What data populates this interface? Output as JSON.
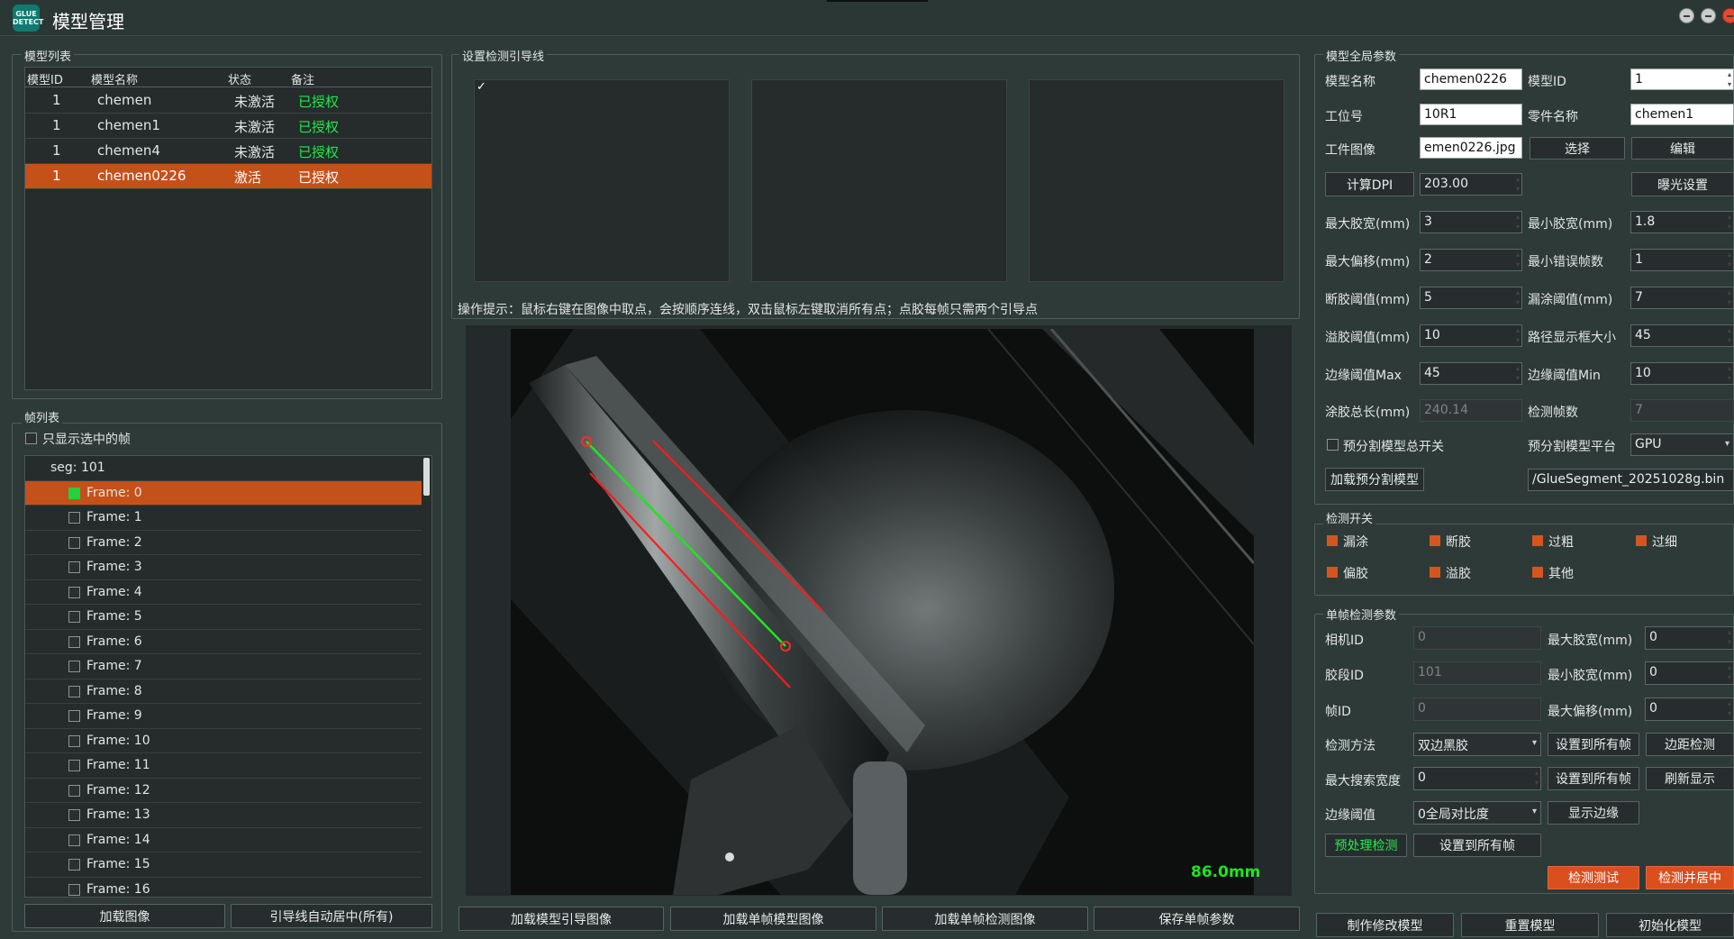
{
  "app": {
    "title": "模型管理",
    "logo_text": "GLUE DETECT"
  },
  "model_list": {
    "title": "模型列表",
    "columns": [
      "模型ID",
      "模型名称",
      "状态",
      "备注"
    ],
    "rows": [
      {
        "id": "1",
        "name": "chemen",
        "status": "未激活",
        "note": "已授权"
      },
      {
        "id": "1",
        "name": "chemen1",
        "status": "未激活",
        "note": "已授权"
      },
      {
        "id": "1",
        "name": "chemen4",
        "status": "未激活",
        "note": "已授权"
      },
      {
        "id": "1",
        "name": "chemen0226",
        "status": "激活",
        "note": "已授权"
      }
    ]
  },
  "frame_list": {
    "title": "帧列表",
    "only_selected_label": "只显示选中的帧",
    "seg_label": "seg: 101",
    "frames": [
      "Frame: 0",
      "Frame: 1",
      "Frame: 2",
      "Frame: 3",
      "Frame: 4",
      "Frame: 5",
      "Frame: 6",
      "Frame: 7",
      "Frame: 8",
      "Frame: 9",
      "Frame: 10",
      "Frame: 11",
      "Frame: 12",
      "Frame: 13",
      "Frame: 14",
      "Frame: 15",
      "Frame: 16"
    ],
    "load_image_button": "加载图像",
    "auto_center_button": "引导线自动居中(所有)"
  },
  "guide_line": {
    "title": "设置检测引导线",
    "check_mark": "✓",
    "hint": "操作提示：鼠标右键在图像中取点，会按顺序连线，双击鼠标左键取消所有点；点胶每帧只需两个引导点",
    "measure_label": "86.0mm",
    "buttons": [
      "加载模型引导图像",
      "加载单帧模型图像",
      "加载单帧检测图像",
      "保存单帧参数"
    ]
  },
  "global_params": {
    "title": "模型全局参数",
    "model_name_label": "模型名称",
    "model_name": "chemen0226",
    "model_id_label": "模型ID",
    "model_id": "1",
    "station_label": "工位号",
    "station": "10R1",
    "part_name_label": "零件名称",
    "part_name": "chemen1",
    "part_image_label": "工件图像",
    "part_image": "emen0226.jpg",
    "select_button": "选择",
    "edit_button": "编辑",
    "calc_dpi_button": "计算DPI",
    "dpi": "203.00",
    "exposure_button": "曝光设置",
    "max_width_label": "最大胶宽(mm)",
    "max_width": "3",
    "min_width_label": "最小胶宽(mm)",
    "min_width": "1.8",
    "max_offset_label": "最大偏移(mm)",
    "max_offset": "2",
    "min_error_frames_label": "最小错误帧数",
    "min_error_frames": "1",
    "break_thresh_label": "断胶阈值(mm)",
    "break_thresh": "5",
    "miss_thresh_label": "漏涂阈值(mm)",
    "miss_thresh": "7",
    "overflow_thresh_label": "溢胶阈值(mm)",
    "overflow_thresh": "10",
    "path_box_label": "路径显示框大小",
    "path_box": "45",
    "edge_max_label": "边缘阈值Max",
    "edge_max": "45",
    "edge_min_label": "边缘阈值Min",
    "edge_min": "10",
    "total_length_label": "涂胶总长(mm)",
    "total_length": "240.14",
    "frame_count_label": "检测帧数",
    "frame_count": "7",
    "preseg_switch_label": "预分割模型总开关",
    "preseg_platform_label": "预分割模型平台",
    "preseg_platform": "GPU",
    "load_preseg_button": "加载预分割模型",
    "preseg_path": "/GlueSegment_20251028g.bin"
  },
  "detect_switch": {
    "title": "检测开关",
    "items": [
      "漏涂",
      "断胶",
      "过粗",
      "过细",
      "偏胶",
      "溢胶",
      "其他"
    ]
  },
  "single_frame": {
    "title": "单帧检测参数",
    "camera_id_label": "相机ID",
    "camera_id": "0",
    "max_width_label": "最大胶宽(mm)",
    "max_width": "0",
    "segment_id_label": "胶段ID",
    "segment_id": "101",
    "min_width_label": "最小胶宽(mm)",
    "min_width": "0",
    "frame_id_label": "帧ID",
    "frame_id": "0",
    "max_offset_label": "最大偏移(mm)",
    "max_offset": "0",
    "method_label": "检测方法",
    "method": "双边黑胶",
    "apply_all_button": "设置到所有帧",
    "edge_detect_button": "边距检测",
    "max_search_label": "最大搜索宽度",
    "max_search": "0",
    "refresh_button": "刷新显示",
    "edge_thresh_label": "边缘阈值",
    "edge_thresh": "0全局对比度",
    "show_edge_button": "显示边缘",
    "preprocess_button": "预处理检测",
    "test_button": "检测测试",
    "detect_center_button": "检测并居中"
  },
  "footer": {
    "buttons": [
      "制作修改模型",
      "重置模型",
      "初始化模型"
    ]
  }
}
